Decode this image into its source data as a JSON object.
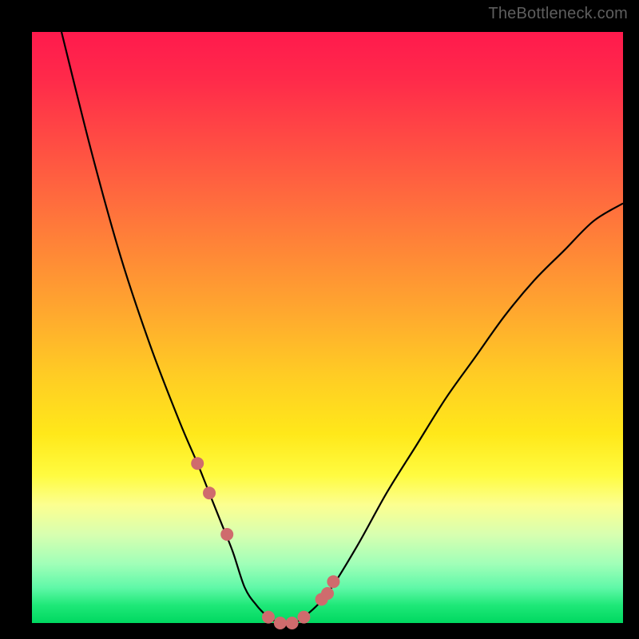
{
  "watermark": "TheBottleneck.com",
  "colors": {
    "background": "#000000",
    "curve_stroke": "#000000",
    "marker_fill": "#cf6b6d",
    "gradient_top": "#ff1a4d",
    "gradient_bottom": "#00d860"
  },
  "chart_data": {
    "type": "line",
    "title": "",
    "xlabel": "",
    "ylabel": "",
    "xlim": [
      0,
      100
    ],
    "ylim": [
      0,
      100
    ],
    "grid": false,
    "series": [
      {
        "name": "bottleneck_curve",
        "x": [
          5,
          10,
          15,
          20,
          25,
          28,
          30,
          32,
          34,
          36,
          38,
          40,
          42,
          44,
          46,
          50,
          55,
          60,
          65,
          70,
          75,
          80,
          85,
          90,
          95,
          100
        ],
        "y": [
          100,
          80,
          62,
          47,
          34,
          27,
          22,
          17,
          12,
          6,
          3,
          1,
          0,
          0,
          1,
          5,
          13,
          22,
          30,
          38,
          45,
          52,
          58,
          63,
          68,
          71
        ]
      }
    ],
    "markers": {
      "name": "highlighted_range",
      "x": [
        28,
        30,
        33,
        40,
        42,
        44,
        46,
        49,
        50,
        51
      ],
      "y": [
        27,
        22,
        15,
        1,
        0,
        0,
        1,
        4,
        5,
        7
      ]
    },
    "annotations": [
      "TheBottleneck.com"
    ]
  }
}
